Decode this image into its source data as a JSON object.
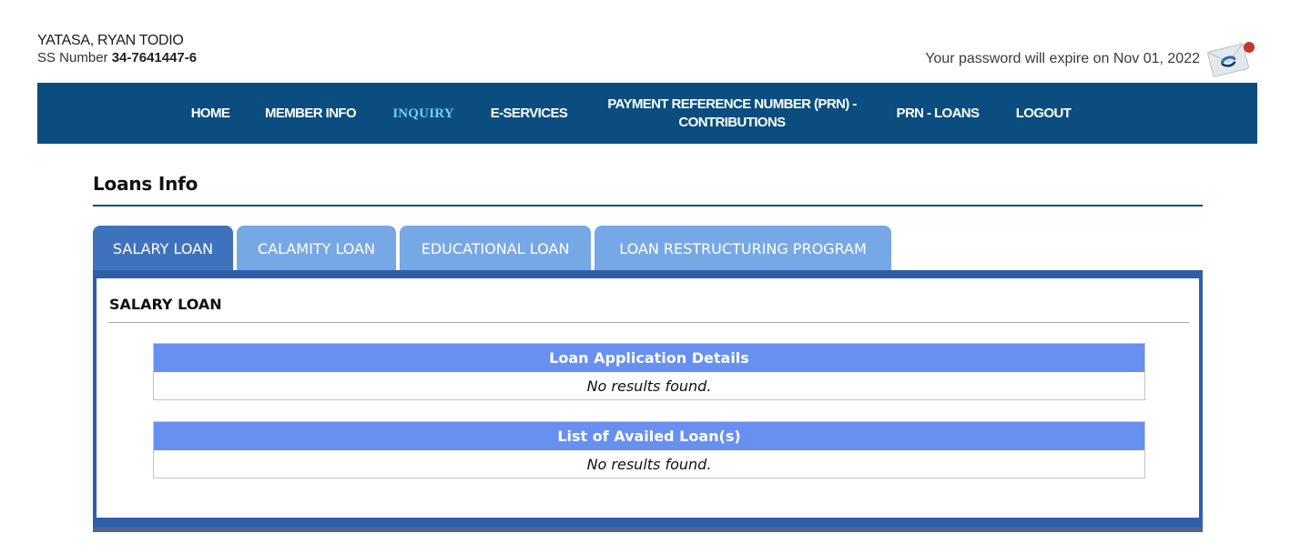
{
  "user": {
    "name": "YATASA, RYAN TODIO",
    "ss_label": "SS Number",
    "ss_number": "34-7641447-6"
  },
  "password_notice": "Your password will expire on Nov 01, 2022",
  "nav": {
    "home": "HOME",
    "member_info": "MEMBER INFO",
    "inquiry": "INQUIRY",
    "eservices": "E-SERVICES",
    "prn_contrib_line1": "PAYMENT REFERENCE NUMBER (PRN) -",
    "prn_contrib_line2": "CONTRIBUTIONS",
    "prn_loans": "PRN - LOANS",
    "logout": "LOGOUT"
  },
  "page": {
    "title": "Loans Info"
  },
  "tabs": {
    "salary": "SALARY LOAN",
    "calamity": "CALAMITY LOAN",
    "educational": "EDUCATIONAL LOAN",
    "restructuring": "LOAN RESTRUCTURING PROGRAM"
  },
  "section": {
    "title": "SALARY LOAN",
    "application_header": "Loan Application Details",
    "application_empty": "No results found.",
    "availed_header": "List of Availed Loan(s)",
    "availed_empty": "No results found."
  },
  "colors": {
    "nav_bg": "#0a4d7e",
    "nav_active": "#6fd0f7",
    "tab_active": "#3f72bd",
    "tab_inactive": "#77a8e6",
    "table_header": "#6890f0",
    "notification_dot": "#c0392b"
  },
  "icons": {
    "mail": "envelope-notification-icon"
  }
}
